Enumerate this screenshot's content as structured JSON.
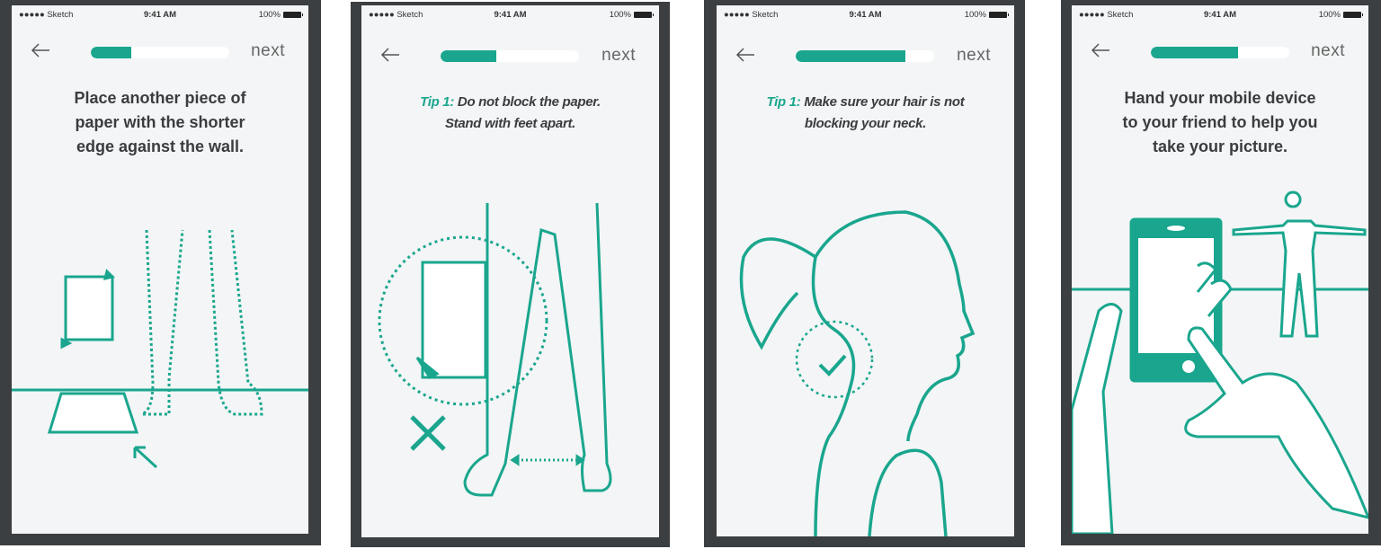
{
  "accent_color": "#1aa68e",
  "status_bar": {
    "carrier": "●●●●● Sketch",
    "wifi_icon": "wifi-icon",
    "time": "9:41 AM",
    "battery": "100%"
  },
  "screens": [
    {
      "progress": 0.29,
      "back_icon": "arrow-left-icon",
      "next_label": "next",
      "lines": [
        "Place another piece of",
        "paper with the shorter",
        "edge against the wall."
      ]
    },
    {
      "progress": 0.4,
      "back_icon": "arrow-left-icon",
      "next_label": "next",
      "tip_label": "Tip 1:",
      "tip_line1": " Do not block the paper.",
      "tip_line2": "Stand with feet apart."
    },
    {
      "progress": 0.79,
      "back_icon": "arrow-left-icon",
      "next_label": "next",
      "tip_label": "Tip 1:",
      "tip_line1": " Make sure your hair is not",
      "tip_line2": "blocking your neck."
    },
    {
      "progress": 0.63,
      "back_icon": "arrow-left-icon",
      "next_label": "next",
      "lines": [
        "Hand your mobile device",
        "to your friend to help you",
        "take your picture."
      ]
    }
  ]
}
